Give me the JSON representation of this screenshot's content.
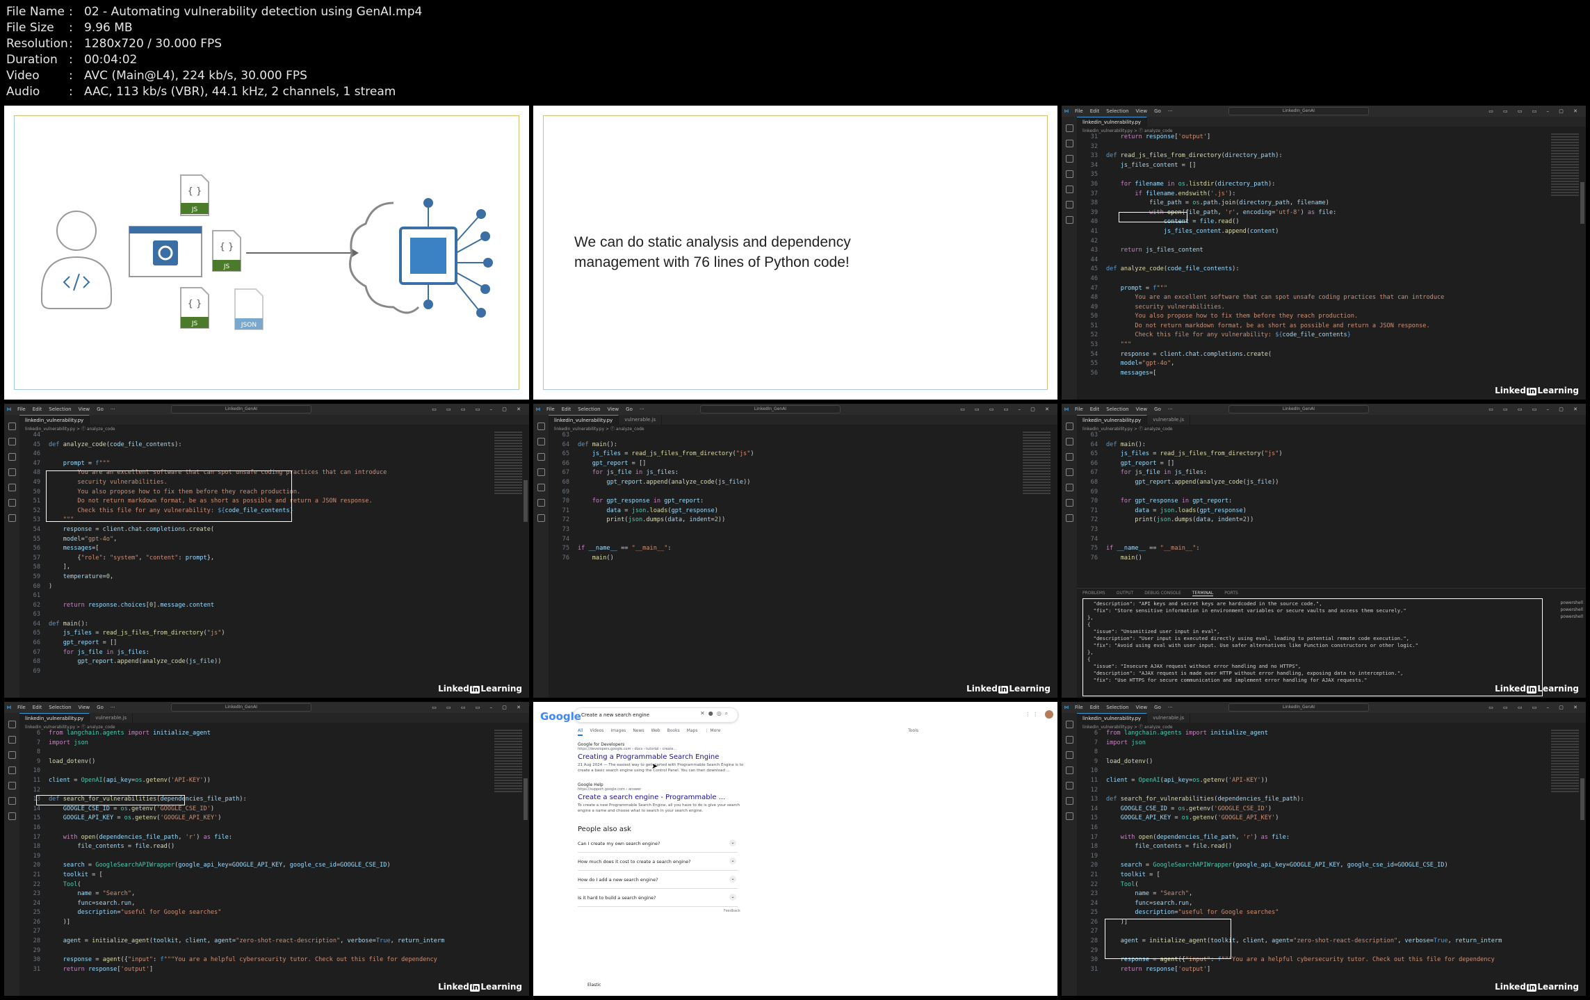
{
  "file_info": [
    {
      "key": "File Name",
      "value": "02 - Automating vulnerability detection using GenAI.mp4"
    },
    {
      "key": "File Size",
      "value": "9.96 MB"
    },
    {
      "key": "Resolution",
      "value": "1280x720 / 30.000 FPS"
    },
    {
      "key": "Duration",
      "value": "00:04:02"
    },
    {
      "key": "Video",
      "value": "AVC (Main@L4), 224 kb/s, 30.000 FPS"
    },
    {
      "key": "Audio",
      "value": "AAC, 113 kb/s (VBR), 44.1 kHz, 2 channels, 1 stream"
    }
  ],
  "slide1": {
    "js1": "{ }",
    "js_label": "JS",
    "json_label": "JSON"
  },
  "slide2": {
    "text": "We can do static analysis and dependency management with 76 lines of Python code!"
  },
  "vscode": {
    "menu": [
      "File",
      "Edit",
      "Selection",
      "View",
      "Go",
      "···"
    ],
    "search": "LinkedIn_GenAI",
    "tab_main": "linkedin_vulnerability.py",
    "tab_second": "vulnerable.js",
    "crumb": "linkedin_vulnerability.py > ⓕ analyze_code",
    "controls": "▭ ▭ ▭ ▭ – ▢ ✕"
  },
  "brand": {
    "linked": "Linked",
    "in": "in",
    "learning": "Learning"
  },
  "terminal": {
    "tabs": [
      "PROBLEMS",
      "OUTPUT",
      "DEBUG CONSOLE",
      "TERMINAL",
      "PORTS"
    ],
    "shells": [
      "powershell",
      "powershell",
      "powershell"
    ],
    "lines": [
      "  \"description\": \"API keys and secret keys are hardcoded in the source code.\",",
      "  \"fix\": \"Store sensitive information in environment variables or secure vaults and access them securely.\"",
      "},",
      "{",
      "  \"issue\": \"Unsanitized user input in eval\",",
      "  \"description\": \"User input is executed directly using eval, leading to potential remote code execution.\",",
      "  \"fix\": \"Avoid using eval with user input. Use safer alternatives like Function constructors or other logic.\"",
      "},",
      "{",
      "  \"issue\": \"Insecure AJAX request without error handling and no HTTPS\",",
      "  \"description\": \"AJAX request is made over HTTP without error handling, exposing data to interception.\",",
      "  \"fix\": \"Use HTTPS for secure communication and implement error handling for AJAX requests.\""
    ]
  },
  "google": {
    "logo": "Google",
    "query": "Create a new search engine",
    "tabs": [
      "All",
      "Videos",
      "Images",
      "News",
      "Web",
      "Books",
      "Maps",
      "⋮ More"
    ],
    "tools": "Tools",
    "r1_src": "Google for Developers",
    "r1_url": "https://developers.google.com › docs › tutorial › create...",
    "r1_title": "Creating a Programmable Search Engine",
    "r1_snip": "21 Aug 2024 — The easiest way to get started with Programmable Search Engine is to create a basic search engine using the Control Panel. You can then download ...",
    "r2_src": "Google Help",
    "r2_url": "https://support.google.com › answer",
    "r2_title": "Create a search engine - Programmable ...",
    "r2_snip": "To create a new Programmable Search Engine, all you have to do is give your search engine a name and choose what to search in your search engine.",
    "paa": "People also ask",
    "questions": [
      "Can I create my own search engine?",
      "How much does it cost to create a search engine?",
      "How do I add a new search engine?",
      "Is it hard to build a search engine?"
    ],
    "feedback": "Feedback",
    "next_src": "Elastic"
  }
}
